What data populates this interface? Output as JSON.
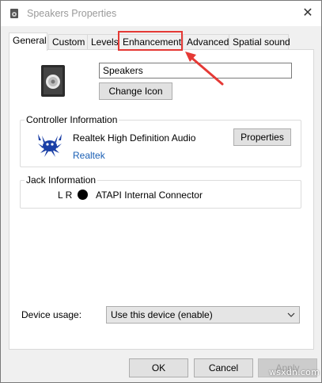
{
  "window": {
    "title": "Speakers Properties",
    "close_glyph": "✕"
  },
  "tabs": [
    {
      "label": "General",
      "active": true
    },
    {
      "label": "Custom",
      "active": false
    },
    {
      "label": "Levels",
      "active": false
    },
    {
      "label": "Enhancements",
      "active": false,
      "highlighted": true
    },
    {
      "label": "Advanced",
      "active": false
    },
    {
      "label": "Spatial sound",
      "active": false
    }
  ],
  "general": {
    "device_name": "Speakers",
    "change_icon_label": "Change Icon",
    "controller": {
      "group_label": "Controller Information",
      "name": "Realtek High Definition Audio",
      "vendor": "Realtek",
      "properties_label": "Properties"
    },
    "jack": {
      "group_label": "Jack Information",
      "channels": "L R",
      "connector": "ATAPI Internal Connector"
    },
    "device_usage": {
      "label": "Device usage:",
      "selected": "Use this device (enable)"
    }
  },
  "footer": {
    "ok_label": "OK",
    "cancel_label": "Cancel",
    "apply_label": "Apply"
  },
  "watermark": "wsxdn.com",
  "colors": {
    "highlight": "#e53935",
    "link": "#1a5fb4"
  },
  "icons": {
    "app": "speaker-icon",
    "device": "speaker-icon",
    "controller": "realtek-crab-icon",
    "annotation": "red-arrow"
  }
}
